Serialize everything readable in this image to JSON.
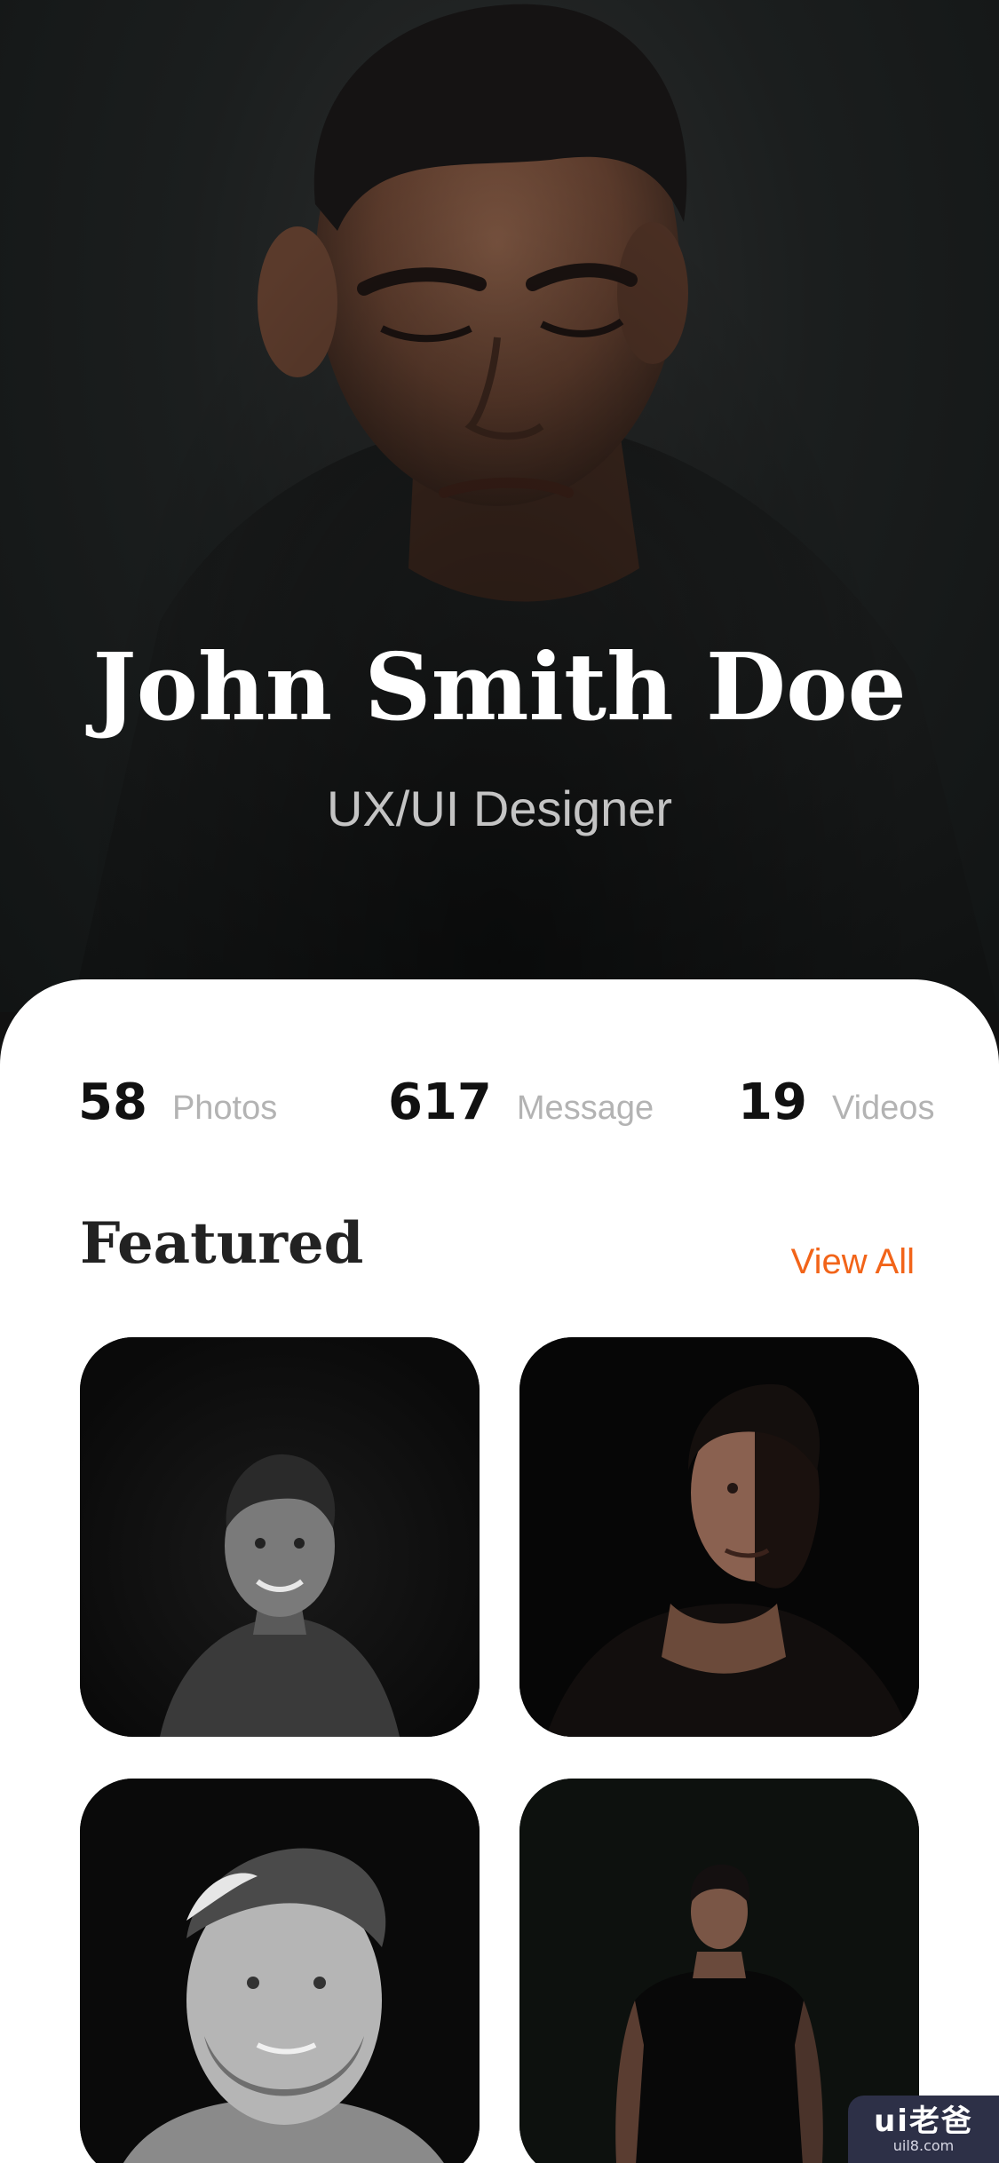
{
  "hero": {
    "name": "John Smith Doe",
    "role": "UX/UI Designer"
  },
  "stats": [
    {
      "value": "58",
      "label": "Photos"
    },
    {
      "value": "617",
      "label": "Message"
    },
    {
      "value": "19",
      "label": "Videos"
    }
  ],
  "featured": {
    "title": "Featured",
    "view_all": "View All"
  },
  "colors": {
    "accent": "#f26419",
    "hero_bg": "#1b1e1e",
    "card_bg": "#ffffff"
  },
  "watermark": {
    "main": "ui老爸",
    "sub": "uil8.com"
  }
}
